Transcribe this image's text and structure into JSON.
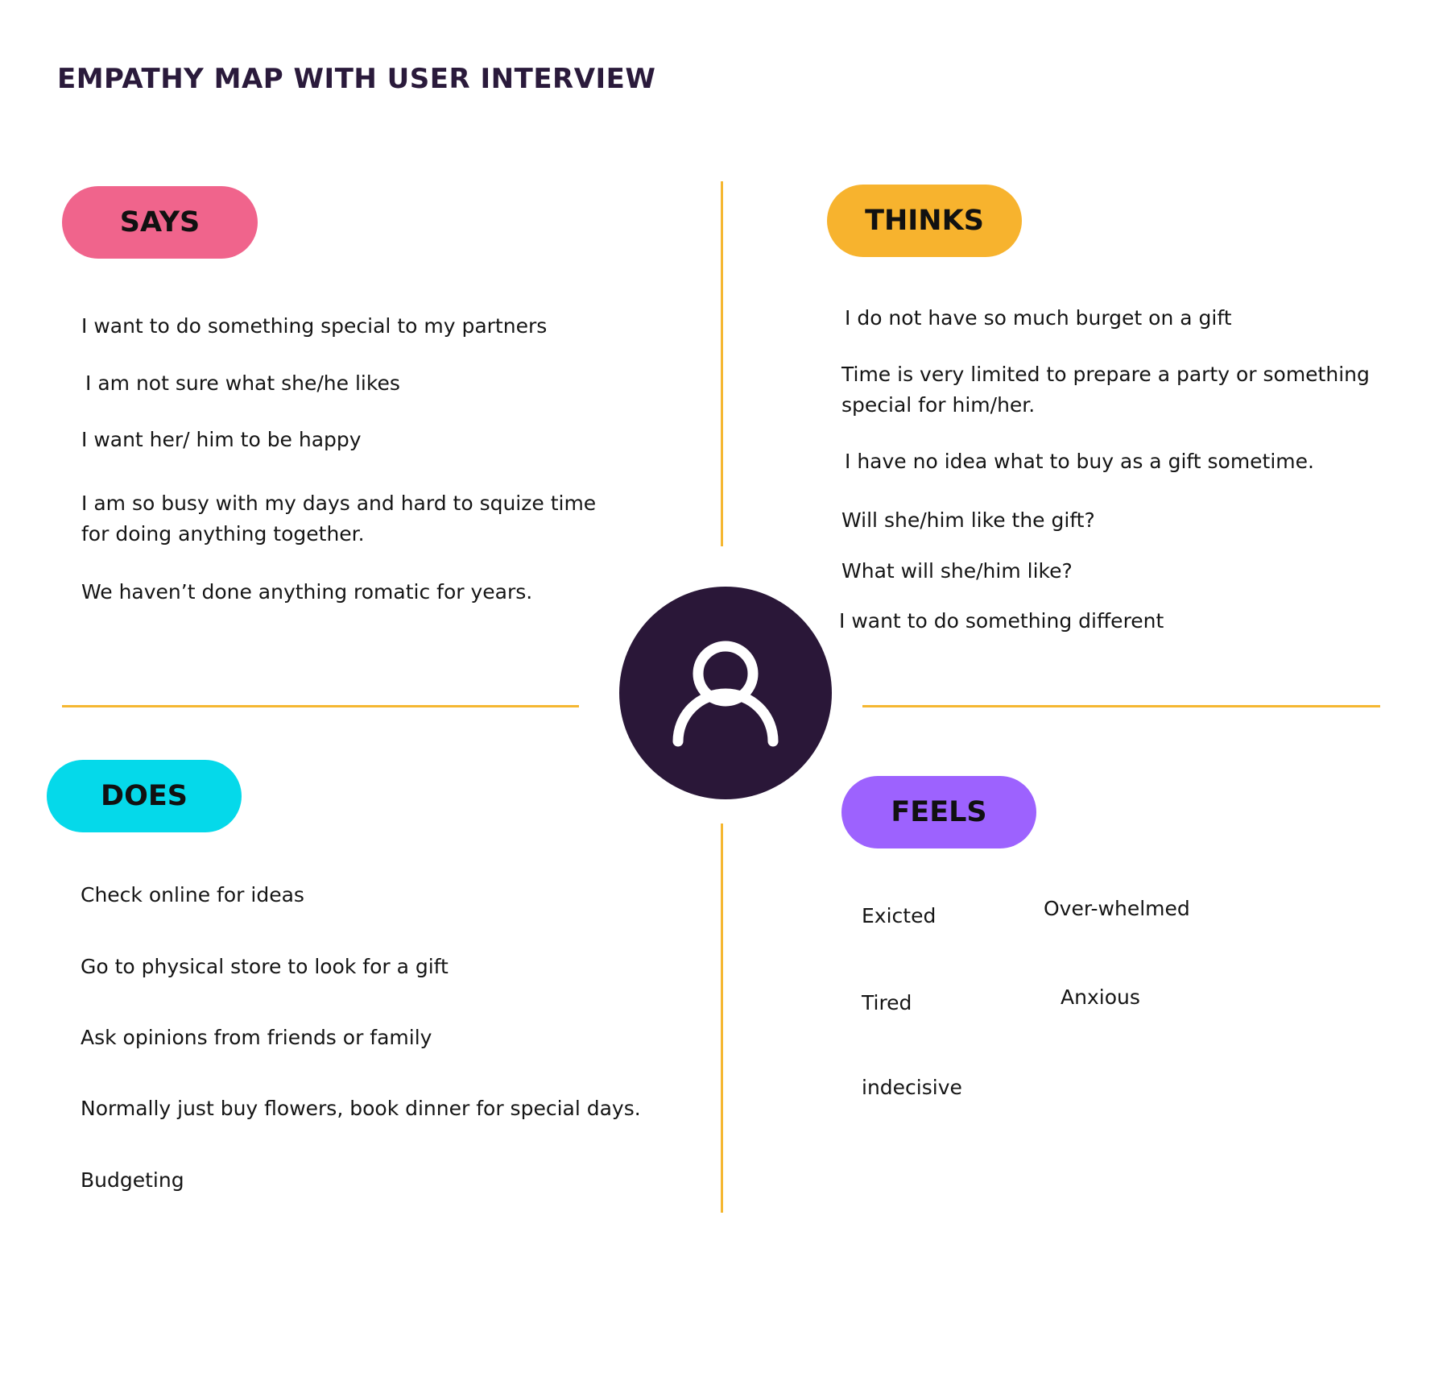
{
  "title": "EMPATHY MAP WITH USER INTERVIEW",
  "colors": {
    "title": "#2a1a3b",
    "divider": "#f5b731",
    "avatar_bg": "#2a1738",
    "avatar_icon": "#ffffff"
  },
  "icons": {
    "center": "user-icon"
  },
  "quadrants": {
    "says": {
      "label": "SAYS",
      "color": "#f0648c",
      "items": [
        "I want to do something special to my partners",
        "I am not sure what she/he likes",
        "I want her/ him to be happy",
        "I am so busy with my days and hard to squize time\nfor doing anything together.",
        "We haven’t done anything romatic for years."
      ]
    },
    "thinks": {
      "label": "THINKS",
      "color": "#f7b32e",
      "items": [
        "I do not have so much burget on a gift",
        "Time is very limited to prepare a party or something\nspecial for him/her.",
        "I have no idea what to buy as a gift sometime.",
        "Will she/him like the gift?",
        "What will she/him like?",
        "I want to do something different"
      ]
    },
    "does": {
      "label": "DOES",
      "color": "#05d9ea",
      "items": [
        "Check online for ideas",
        "Go to physical store  to look for a gift",
        "Ask opinions from friends or family",
        "Normally just buy flowers, book dinner for special days.",
        "Budgeting"
      ]
    },
    "feels": {
      "label": "FEELS",
      "color": "#9d62fe",
      "items": [
        "Exicted",
        "Over-whelmed",
        "Tired",
        "Anxious",
        "indecisive"
      ]
    }
  }
}
